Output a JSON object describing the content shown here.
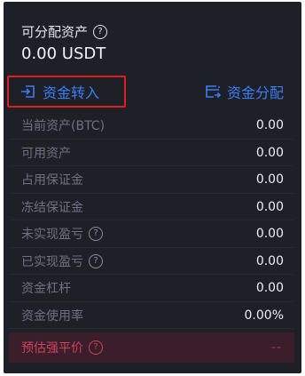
{
  "available": {
    "label": "可分配资产",
    "value": "0.00 USDT"
  },
  "actions": {
    "transfer_in": "资金转入",
    "allocate": "资金分配"
  },
  "rows": [
    {
      "label": "当前资产(BTC)",
      "value": "0.00"
    },
    {
      "label": "可用资产",
      "value": "0.00"
    },
    {
      "label": "占用保证金",
      "value": "0.00"
    },
    {
      "label": "冻结保证金",
      "value": "0.00"
    },
    {
      "label": "未实现盈亏",
      "value": "0.00"
    },
    {
      "label": "已实现盈亏",
      "value": "0.00"
    },
    {
      "label": "资金杠杆",
      "value": "0.00"
    },
    {
      "label": "资金使用率",
      "value": "0.00%"
    }
  ],
  "liquidation": {
    "label": "预估强平价",
    "value": "--"
  },
  "colors": {
    "panel_bg": "#1e2028",
    "accent_blue": "#3d7cf5",
    "highlight_red": "#e11d1d",
    "liquidation_bg": "#3a1f2a",
    "liquidation_text": "#d0405f"
  },
  "icons": {
    "help": "help-circle-icon",
    "transfer_in": "transfer-in-icon",
    "allocate": "allocate-icon"
  }
}
